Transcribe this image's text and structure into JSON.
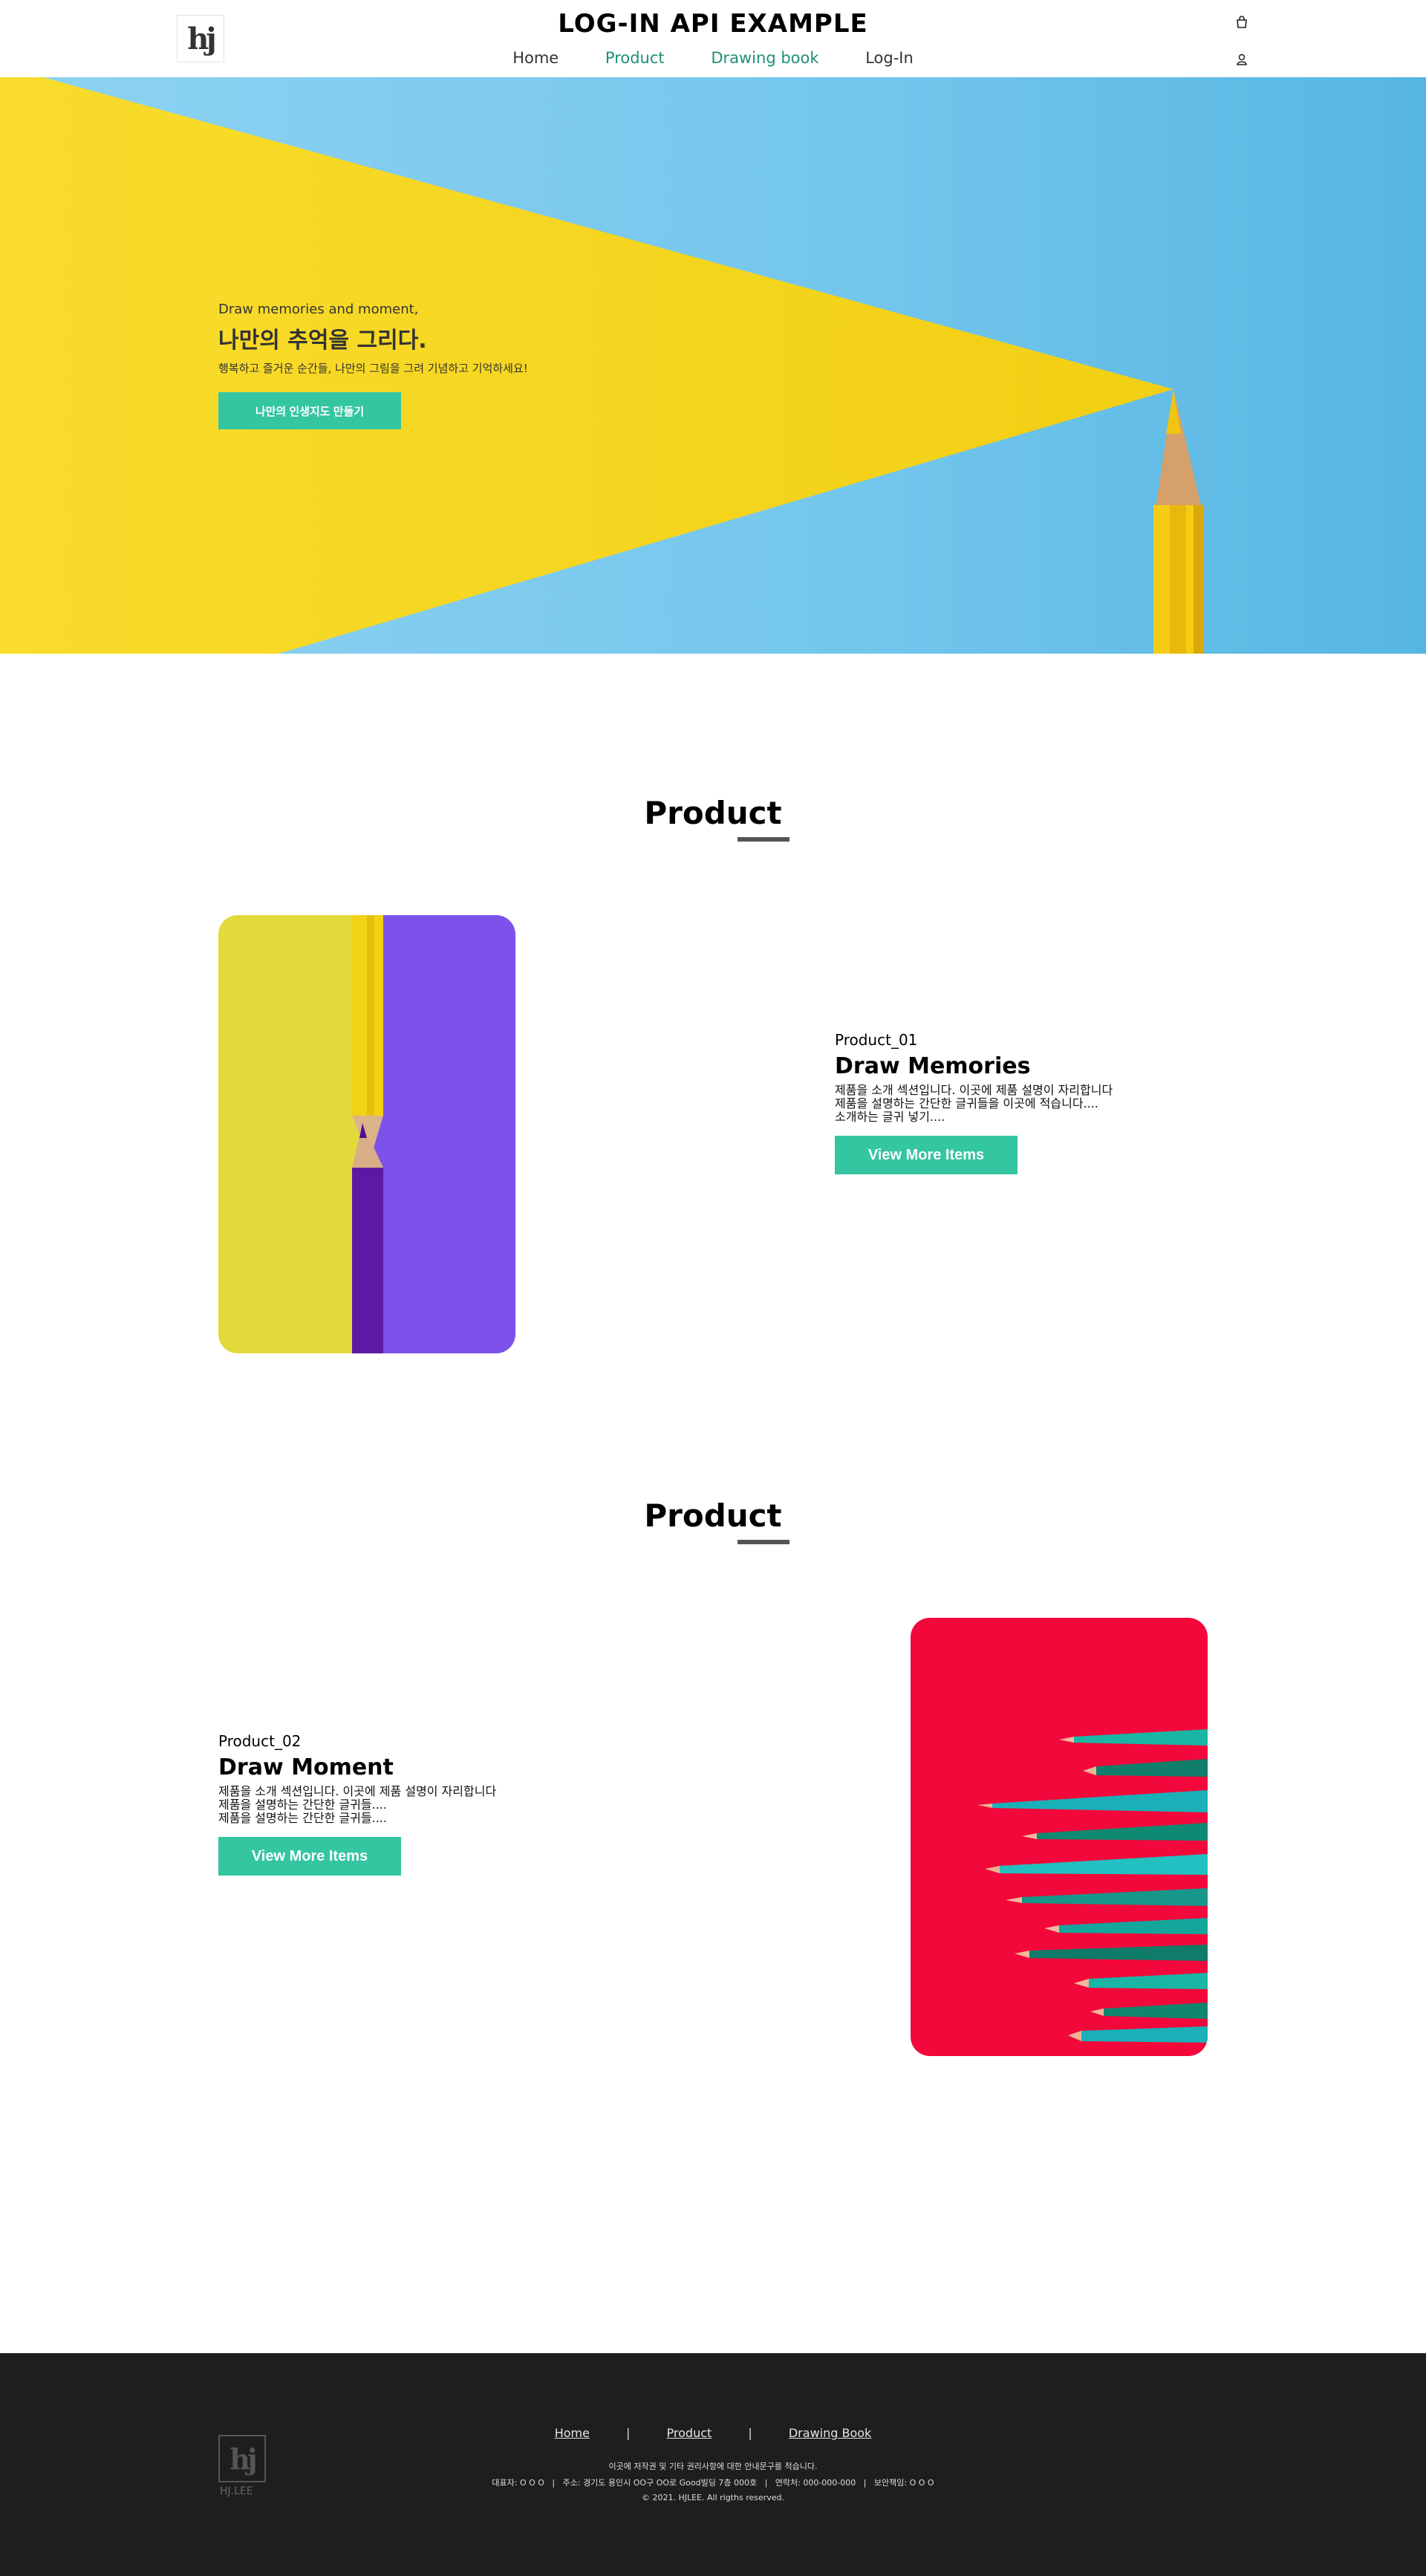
{
  "header": {
    "title": "LOG-IN API EXAMPLE",
    "logo_text": "hj",
    "nav": [
      "Home",
      "Product",
      "Drawing book",
      "Log-In"
    ],
    "cart_icon": "shopping-bag-icon",
    "user_icon": "user-icon"
  },
  "hero": {
    "subtitle": "Draw memories and moment,",
    "title": "나만의 추억을 그리다.",
    "description": "행복하고 즐거운 순간들, 나만의 그림을 그려 기념하고 기억하세요!",
    "button": "나만의 인생지도 만들기"
  },
  "products": [
    {
      "section_title": "Product",
      "code": "Product_01",
      "name": "Draw Memories",
      "desc": [
        "제품을 소개 섹션입니다. 이곳에 제품 설명이 자리합니다",
        "제품을 설명하는 간단한 글귀들을 이곳에 적습니다....",
        "소개하는 글귀 넣기...."
      ],
      "button": "View More Items"
    },
    {
      "section_title": "Product",
      "code": "Product_02",
      "name": "Draw Moment",
      "desc": [
        "제품을 소개 섹션입니다. 이곳에 제품 설명이 자리합니다",
        "제품을 설명하는 간단한 글귀들....",
        "제품을 설명하는 간단한 글귀들...."
      ],
      "button": "View More Items"
    }
  ],
  "footer": {
    "logo_text": "hj",
    "logo_name": "HJ.LEE",
    "nav": [
      "Home",
      "Product",
      "Drawing Book"
    ],
    "separator": "|",
    "notice": "이곳에 저작권 및 기타 권리사항에 대한 안내문구를 적습니다.",
    "info": "대표자: O O O   |   주소: 경기도 용인시 OO구 OO로 Good빌딩 7층 000호   |   연락처: 000-000-000   |   보안책임: O O O",
    "copyright": "© 2021. HJLEE. All rigths reserved."
  },
  "colors": {
    "accent": "#34c5a1",
    "nav_accent": "#1f8f78",
    "hero_yellow": "#f7d51e",
    "hero_blue": "#74c6ec",
    "footer_bg": "#1e1e1e"
  }
}
